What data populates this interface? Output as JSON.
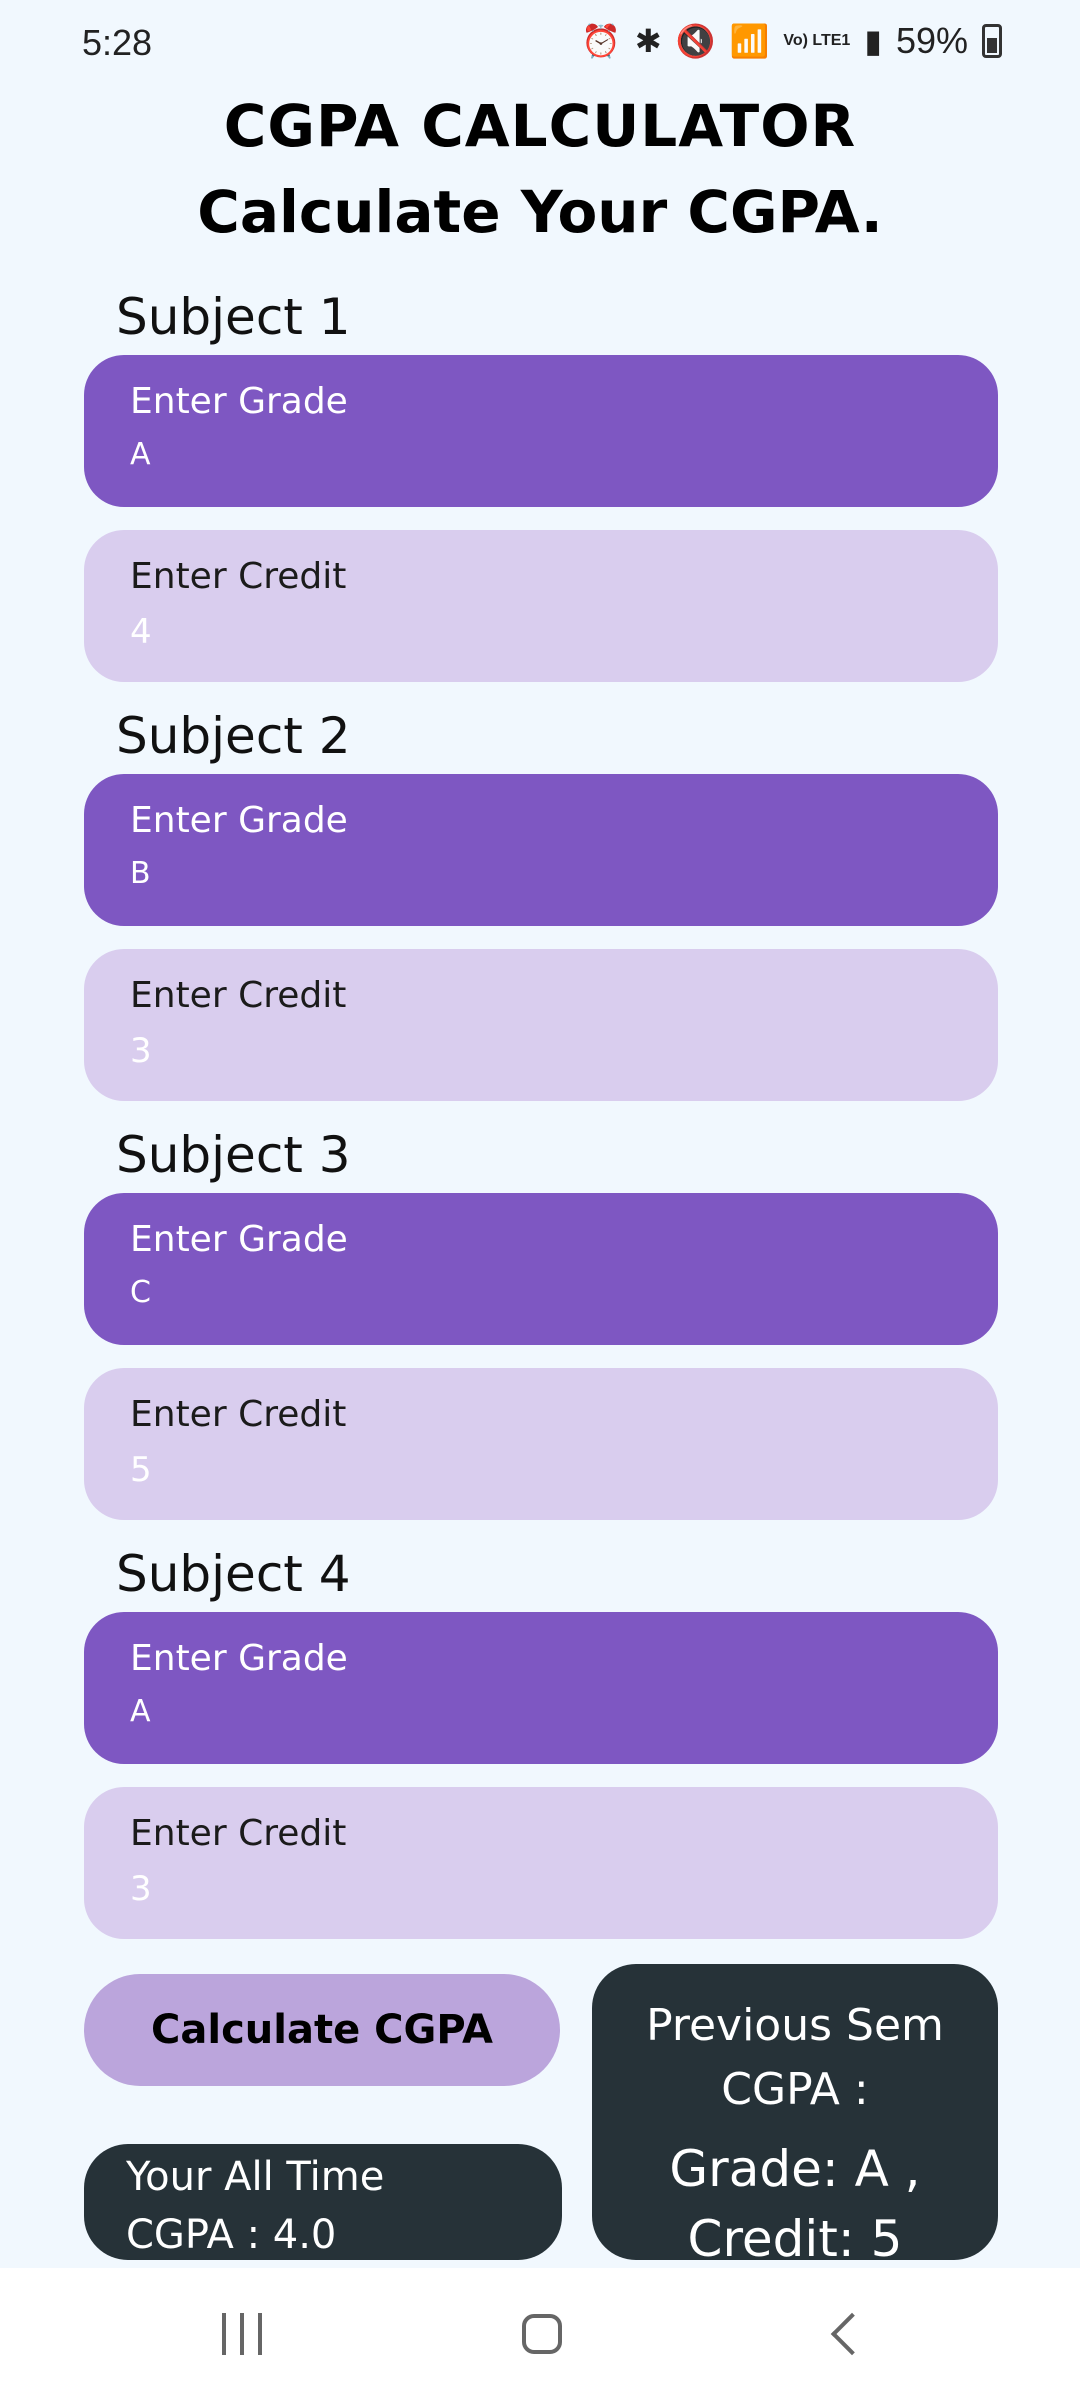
{
  "status_bar": {
    "time": "5:28",
    "battery_text": "59%",
    "network_label": "Vo) LTE1",
    "icons": [
      "alarm-icon",
      "bluetooth-icon",
      "mute-icon",
      "wifi-icon",
      "signal-icon",
      "battery-icon"
    ]
  },
  "header": {
    "title": "CGPA CALCULATOR",
    "subtitle": "Calculate Your CGPA."
  },
  "subjects": [
    {
      "label": "Subject 1",
      "grade_label": "Enter Grade",
      "grade_value": "A",
      "credit_label": "Enter Credit",
      "credit_value": "4"
    },
    {
      "label": "Subject 2",
      "grade_label": "Enter Grade",
      "grade_value": "B",
      "credit_label": "Enter Credit",
      "credit_value": "3"
    },
    {
      "label": "Subject 3",
      "grade_label": "Enter Grade",
      "grade_value": "C",
      "credit_label": "Enter Credit",
      "credit_value": "5"
    },
    {
      "label": "Subject 4",
      "grade_label": "Enter Grade",
      "grade_value": "A",
      "credit_label": "Enter Credit",
      "credit_value": "3"
    }
  ],
  "actions": {
    "calculate_label": "Calculate CGPA"
  },
  "results": {
    "all_time_line1": "Your All Time",
    "all_time_line2": "CGPA : 4.0",
    "prev_sem_title": "Previous Sem CGPA :",
    "prev_sem_grade": "Grade: A ,",
    "prev_sem_credit": "Credit: 5"
  },
  "colors": {
    "background": "#f1f8fe",
    "grade_field": "#7e57c2",
    "credit_field": "#d9cdee",
    "calc_button": "#bba5dc",
    "dark_card": "#263238"
  }
}
